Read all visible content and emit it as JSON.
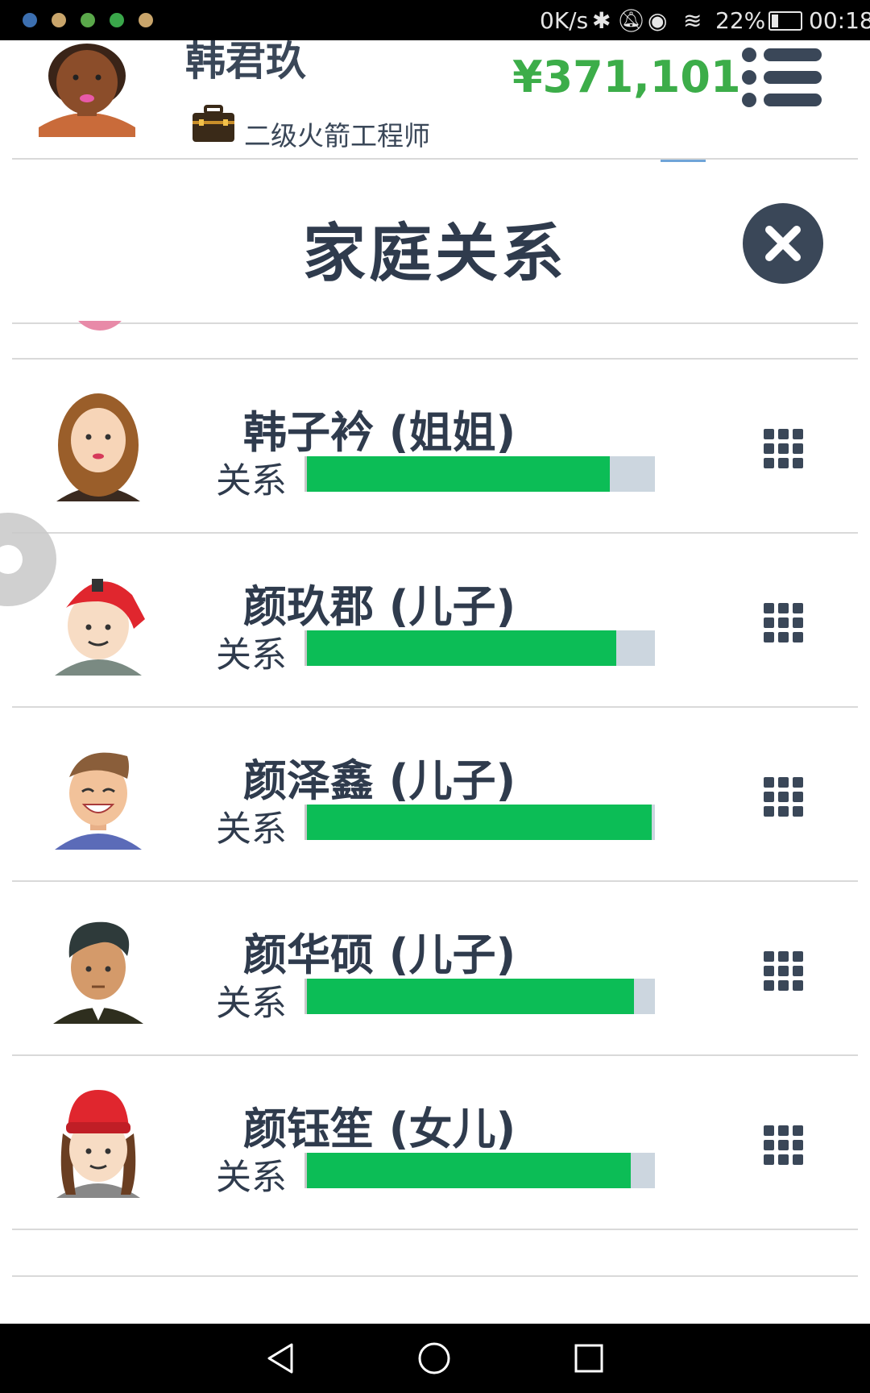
{
  "status_bar": {
    "speed": "0K/s",
    "battery": "22%",
    "time": "00:18"
  },
  "header": {
    "user_name": "韩君玖",
    "job_title": "二级火箭工程师",
    "money": "¥371,101",
    "job_icon": "briefcase-icon",
    "menu_icon": "menu-list-icon"
  },
  "modal": {
    "title": "家庭关系",
    "close_icon": "close-icon"
  },
  "relation_label": "关系",
  "members": [
    {
      "name": "韩子衿 (姐姐)",
      "relation": 0.87,
      "avatar": "woman-brown-hair-avatar"
    },
    {
      "name": "颜玖郡 (儿子)",
      "relation": 0.89,
      "avatar": "boy-red-cap-avatar"
    },
    {
      "name": "颜泽鑫 (儿子)",
      "relation": 0.99,
      "avatar": "boy-smiling-avatar"
    },
    {
      "name": "颜华硕 (儿子)",
      "relation": 0.94,
      "avatar": "man-dark-hair-avatar"
    },
    {
      "name": "颜钰笙 (女儿)",
      "relation": 0.93,
      "avatar": "girl-red-hat-avatar"
    }
  ],
  "colors": {
    "money": "#3cad49",
    "bar_fill": "#0cbd56",
    "bar_track": "#ccd6df",
    "text": "#2f3b4d"
  }
}
